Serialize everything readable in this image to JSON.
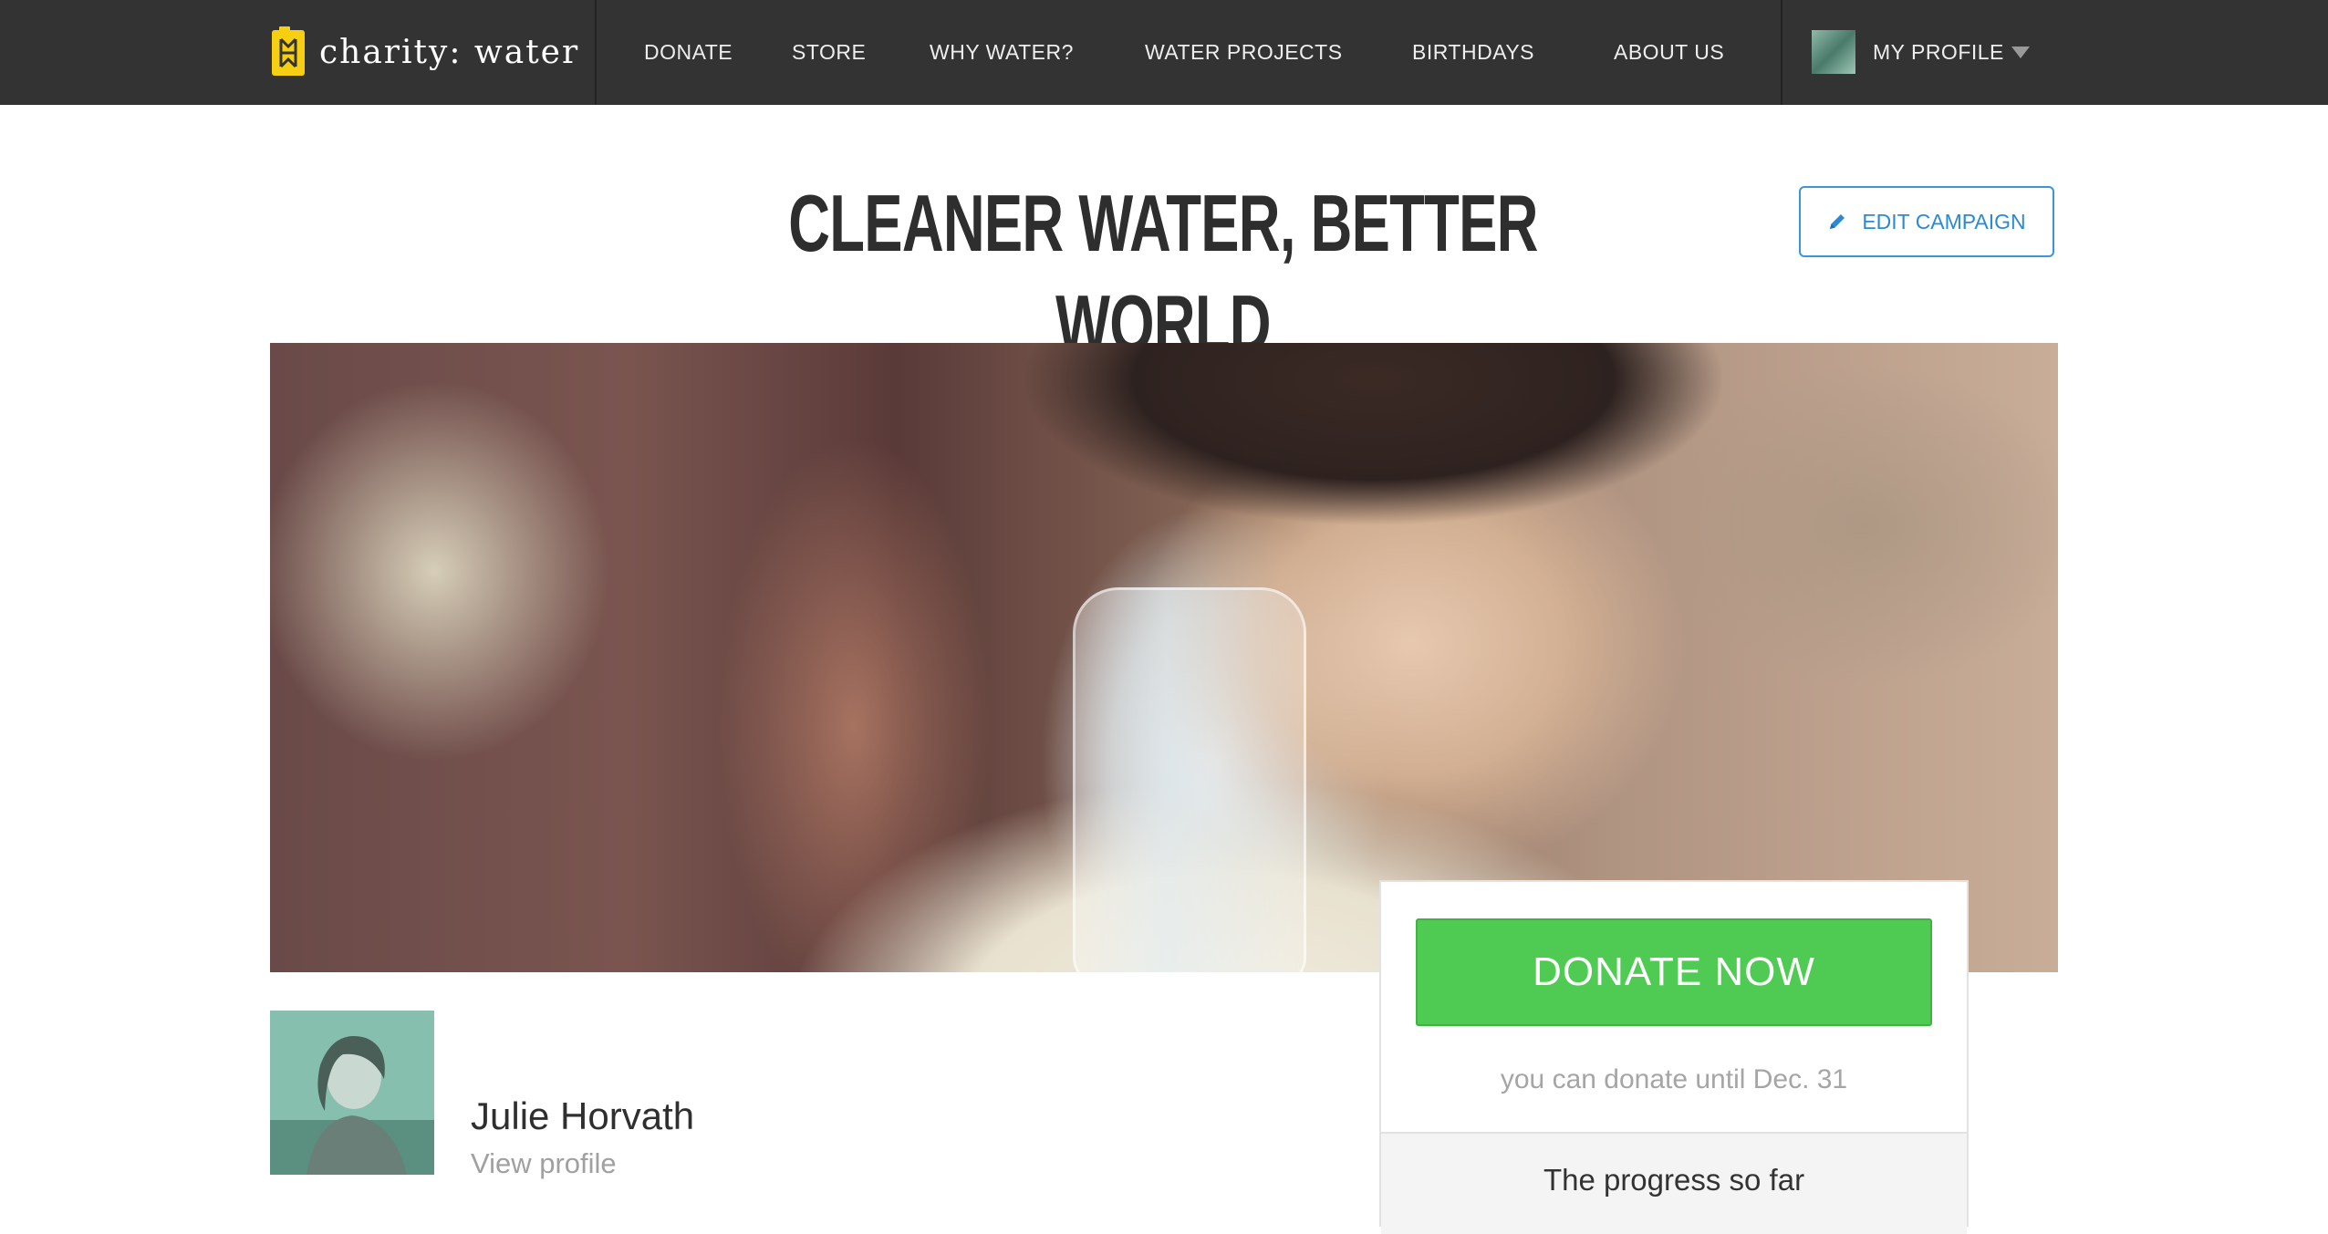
{
  "brand": {
    "name": "charity: water",
    "accent": "#f7cf12"
  },
  "nav": {
    "items": [
      {
        "label": "DONATE"
      },
      {
        "label": "STORE"
      },
      {
        "label": "WHY WATER?"
      },
      {
        "label": "WATER PROJECTS"
      },
      {
        "label": "BIRTHDAYS"
      },
      {
        "label": "ABOUT US"
      }
    ],
    "profile_label": "MY PROFILE"
  },
  "campaign": {
    "title": "CLEANER WATER, BETTER WORLD",
    "edit_label": "EDIT CAMPAIGN"
  },
  "donate": {
    "button_label": "DONATE NOW",
    "note": "you can donate until Dec. 31",
    "progress_title": "The progress so far",
    "button_color": "#4fcb53"
  },
  "owner": {
    "name": "Julie Horvath",
    "link_label": "View profile"
  }
}
